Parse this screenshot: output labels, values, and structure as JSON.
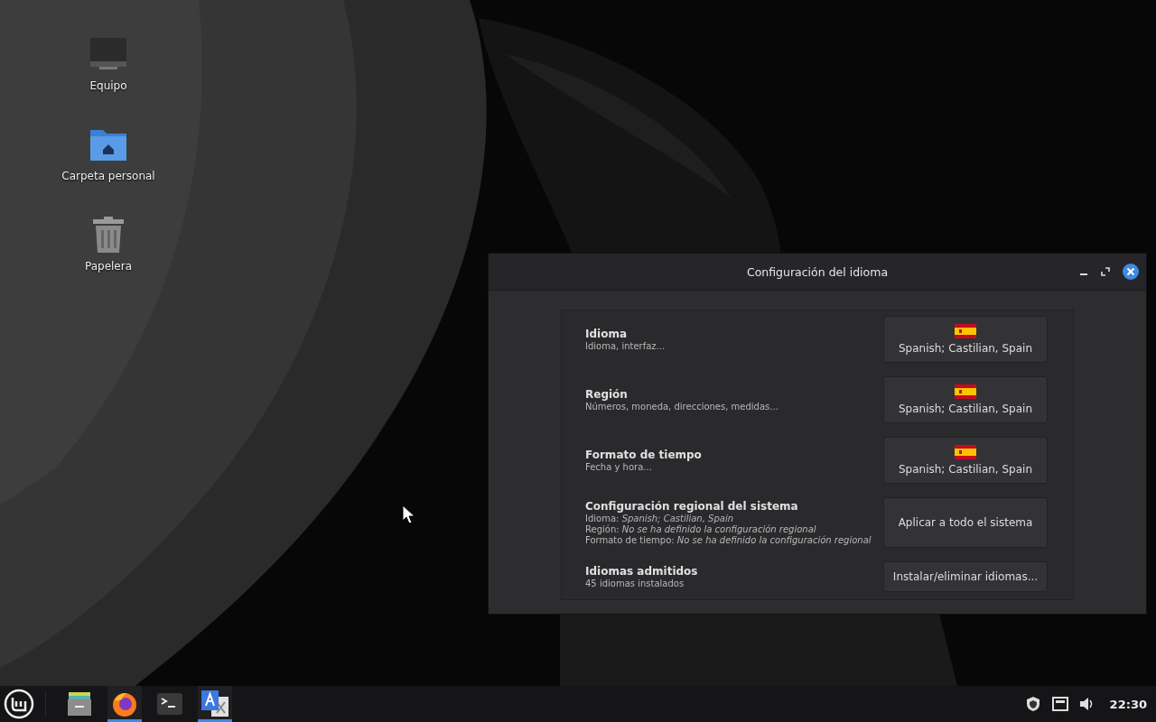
{
  "desktop_icons": [
    {
      "kind": "computer",
      "label": "Equipo"
    },
    {
      "kind": "home",
      "label": "Carpeta personal"
    },
    {
      "kind": "trash",
      "label": "Papelera"
    }
  ],
  "window": {
    "title": "Configuración del idioma",
    "rows": [
      {
        "kind": "flag",
        "title": "Idioma",
        "lines": [
          "Idioma, interfaz..."
        ],
        "button": "Spanish; Castilian, Spain"
      },
      {
        "kind": "flag",
        "title": "Región",
        "lines": [
          "Números, moneda, direcciones, medidas..."
        ],
        "button": "Spanish; Castilian, Spain"
      },
      {
        "kind": "flag",
        "title": "Formato de tiempo",
        "lines": [
          "Fecha y hora..."
        ],
        "button": "Spanish; Castilian, Spain"
      },
      {
        "kind": "text",
        "title": "Configuración regional del sistema",
        "lines": [
          "Idioma: *Spanish; Castilian, Spain*",
          "Región: *No se ha definido la configuración regional*",
          "Formato de tiempo: *No se ha definido la configuración regional*"
        ],
        "button": "Aplicar a todo el sistema"
      },
      {
        "kind": "text",
        "title": "Idiomas admitidos",
        "lines": [
          "45 idiomas instalados"
        ],
        "button": "Instalar/eliminar idiomas..."
      }
    ]
  },
  "taskbar": {
    "apps": [
      {
        "kind": "files",
        "running": false
      },
      {
        "kind": "firefox",
        "running": true
      },
      {
        "kind": "terminal",
        "running": false
      },
      {
        "kind": "translate",
        "running": true
      }
    ],
    "clock": "22:30"
  }
}
